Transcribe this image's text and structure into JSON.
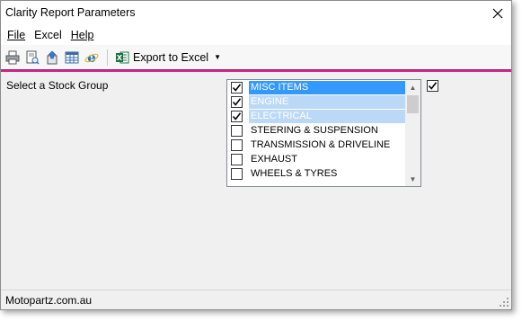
{
  "window": {
    "title": "Clarity Report Parameters"
  },
  "menu": {
    "items": [
      "File",
      "Excel",
      "Help"
    ]
  },
  "toolbar": {
    "icons": [
      "print-icon",
      "print-preview-icon",
      "export-icon",
      "table-icon",
      "ie-icon"
    ],
    "export_label": "Export to Excel"
  },
  "form": {
    "stock_group_label": "Select a Stock Group",
    "select_all_checked": true,
    "stock_groups": [
      {
        "label": "MISC ITEMS",
        "checked": true,
        "state": "primary"
      },
      {
        "label": "ENGINE",
        "checked": true,
        "state": "secondary"
      },
      {
        "label": "ELECTRICAL",
        "checked": true,
        "state": "secondary"
      },
      {
        "label": "STEERING & SUSPENSION",
        "checked": false,
        "state": "none"
      },
      {
        "label": "TRANSMISSION & DRIVELINE",
        "checked": false,
        "state": "none"
      },
      {
        "label": "EXHAUST",
        "checked": false,
        "state": "none"
      },
      {
        "label": "WHEELS & TYRES",
        "checked": false,
        "state": "none"
      }
    ]
  },
  "status": {
    "text": "Motopartz.com.au"
  },
  "colors": {
    "accent_top": "#7a2d7e",
    "accent_bottom": "#e0208c",
    "selection": "#3399ff",
    "selection_inactive": "#bbd9f7"
  }
}
